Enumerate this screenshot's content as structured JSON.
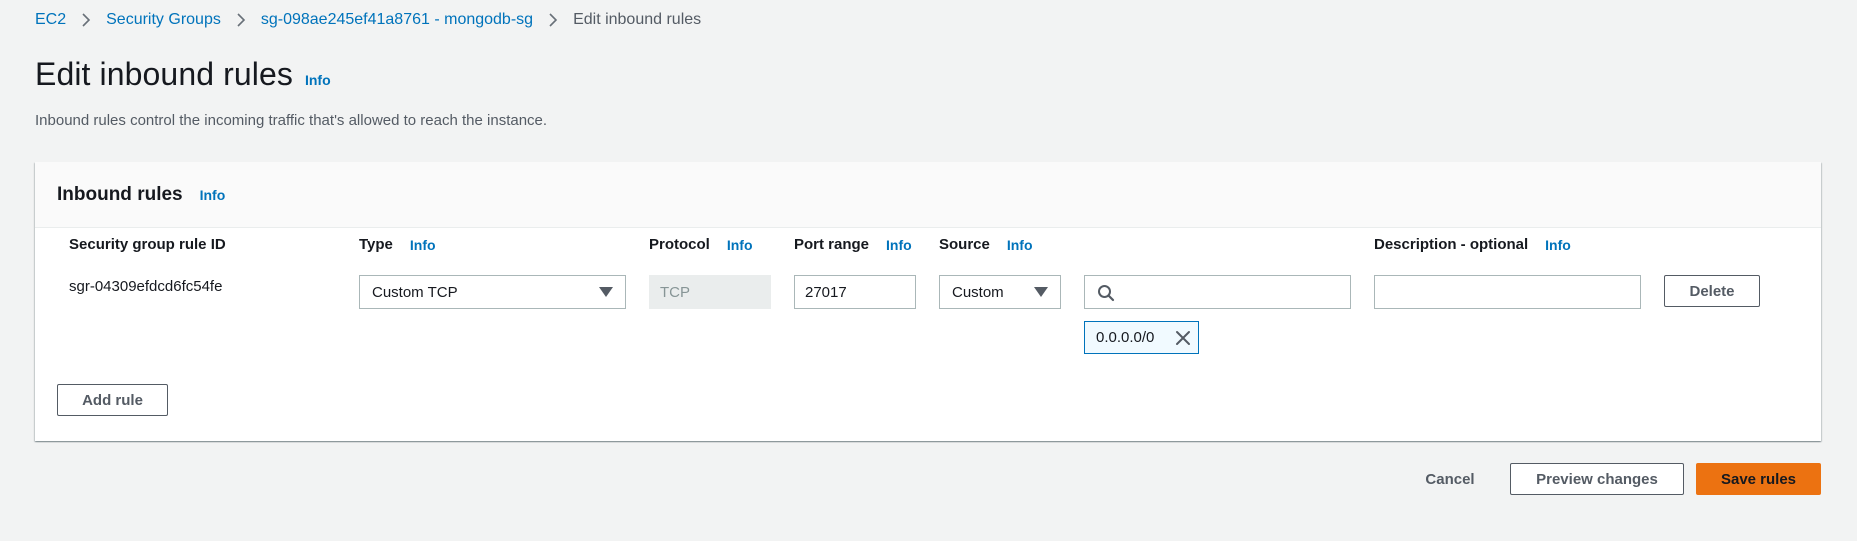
{
  "breadcrumb": {
    "items": [
      "EC2",
      "Security Groups",
      "sg-098ae245ef41a8761 - mongodb-sg",
      "Edit inbound rules"
    ]
  },
  "page": {
    "title": "Edit inbound rules",
    "info": "Info",
    "description": "Inbound rules control the incoming traffic that's allowed to reach the instance."
  },
  "panel": {
    "title": "Inbound rules",
    "info": "Info",
    "columns": {
      "rule_id": "Security group rule ID",
      "type": "Type",
      "protocol": "Protocol",
      "port_range": "Port range",
      "source": "Source",
      "description": "Description - optional",
      "info": "Info"
    },
    "rule": {
      "id": "sgr-04309efdcd6fc54fe",
      "type": "Custom TCP",
      "protocol": "TCP",
      "port_range": "27017",
      "source": "Custom",
      "source_search": "",
      "source_token": "0.0.0.0/0",
      "description": "",
      "delete_label": "Delete"
    },
    "add_rule_label": "Add rule"
  },
  "footer": {
    "cancel_label": "Cancel",
    "preview_label": "Preview changes",
    "save_label": "Save rules"
  },
  "colors": {
    "link": "#0073bb",
    "primary": "#ec7211",
    "background": "#f2f3f3"
  }
}
